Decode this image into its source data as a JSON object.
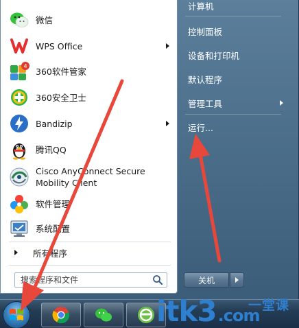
{
  "programs": [
    {
      "label": "微信",
      "icon": "wechat-icon",
      "has_submenu": false
    },
    {
      "label": "WPS Office",
      "icon": "wps-icon",
      "has_submenu": true
    },
    {
      "label": "360软件管家",
      "icon": "360-software-manager-icon",
      "has_submenu": false,
      "badge": "4"
    },
    {
      "label": "360安全卫士",
      "icon": "360-security-icon",
      "has_submenu": false
    },
    {
      "label": "Bandizip",
      "icon": "bandizip-icon",
      "has_submenu": true
    },
    {
      "label": "腾讯QQ",
      "icon": "qq-penguin-icon",
      "has_submenu": false
    },
    {
      "label_line1": "Cisco AnyConnect Secure",
      "label_line2": "Mobility Client",
      "icon": "cisco-anyconnect-icon",
      "has_submenu": false
    },
    {
      "label": "软件管理",
      "icon": "software-manager-icon",
      "has_submenu": false
    },
    {
      "label": "系统配置",
      "icon": "system-config-icon",
      "has_submenu": false
    }
  ],
  "all_programs_label": "所有程序",
  "search": {
    "placeholder": "搜索程序和文件"
  },
  "right_items": [
    {
      "label": "计算机",
      "has_submenu": false
    },
    {
      "label": "控制面板",
      "has_submenu": false
    },
    {
      "label": "设备和打印机",
      "has_submenu": false
    },
    {
      "label": "默认程序",
      "has_submenu": false
    },
    {
      "label": "管理工具",
      "has_submenu": true
    },
    {
      "label": "运行...",
      "has_submenu": false
    }
  ],
  "shutdown_label": "关机",
  "taskbar": [
    {
      "icon": "chrome-icon"
    },
    {
      "icon": "wechat-icon"
    },
    {
      "icon": "360-browser-icon"
    }
  ],
  "watermark": {
    "main": "itk3",
    "ext": ".com",
    "sub": "一堂课"
  },
  "colors": {
    "arrow_annotation": "#e8483b",
    "watermark": "#2f7fd0"
  }
}
